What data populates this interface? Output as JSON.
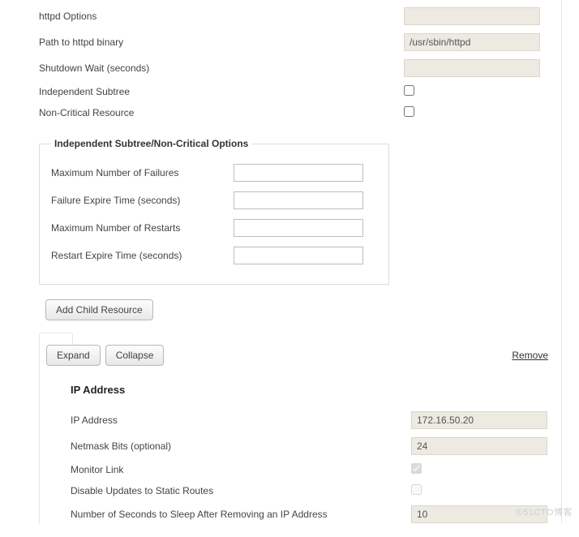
{
  "top": {
    "httpd_options": {
      "label": "httpd Options",
      "value": ""
    },
    "path_binary": {
      "label": "Path to httpd binary",
      "value": "/usr/sbin/httpd"
    },
    "shutdown_wait": {
      "label": "Shutdown Wait (seconds)",
      "value": ""
    },
    "indep_subtree": {
      "label": "Independent Subtree",
      "checked": false
    },
    "non_critical": {
      "label": "Non-Critical Resource",
      "checked": false
    }
  },
  "group": {
    "legend": "Independent Subtree/Non-Critical Options",
    "max_failures": {
      "label": "Maximum Number of Failures",
      "value": ""
    },
    "fail_expire": {
      "label": "Failure Expire Time (seconds)",
      "value": ""
    },
    "max_restarts": {
      "label": "Maximum Number of Restarts",
      "value": ""
    },
    "restart_expire": {
      "label": "Restart Expire Time (seconds)",
      "value": ""
    }
  },
  "buttons": {
    "add_child": "Add Child Resource",
    "expand": "Expand",
    "collapse": "Collapse",
    "remove": "Remove"
  },
  "child": {
    "title": "IP Address",
    "ip_address": {
      "label": "IP Address",
      "value": "172.16.50.20"
    },
    "netmask": {
      "label": "Netmask Bits (optional)",
      "value": "24"
    },
    "monitor": {
      "label": "Monitor Link",
      "checked": true
    },
    "disable_upd": {
      "label": "Disable Updates to Static Routes",
      "checked": false
    },
    "sleep_after": {
      "label": "Number of Seconds to Sleep After Removing an IP Address",
      "value": "10"
    }
  },
  "watermark": "©51CTO博客"
}
